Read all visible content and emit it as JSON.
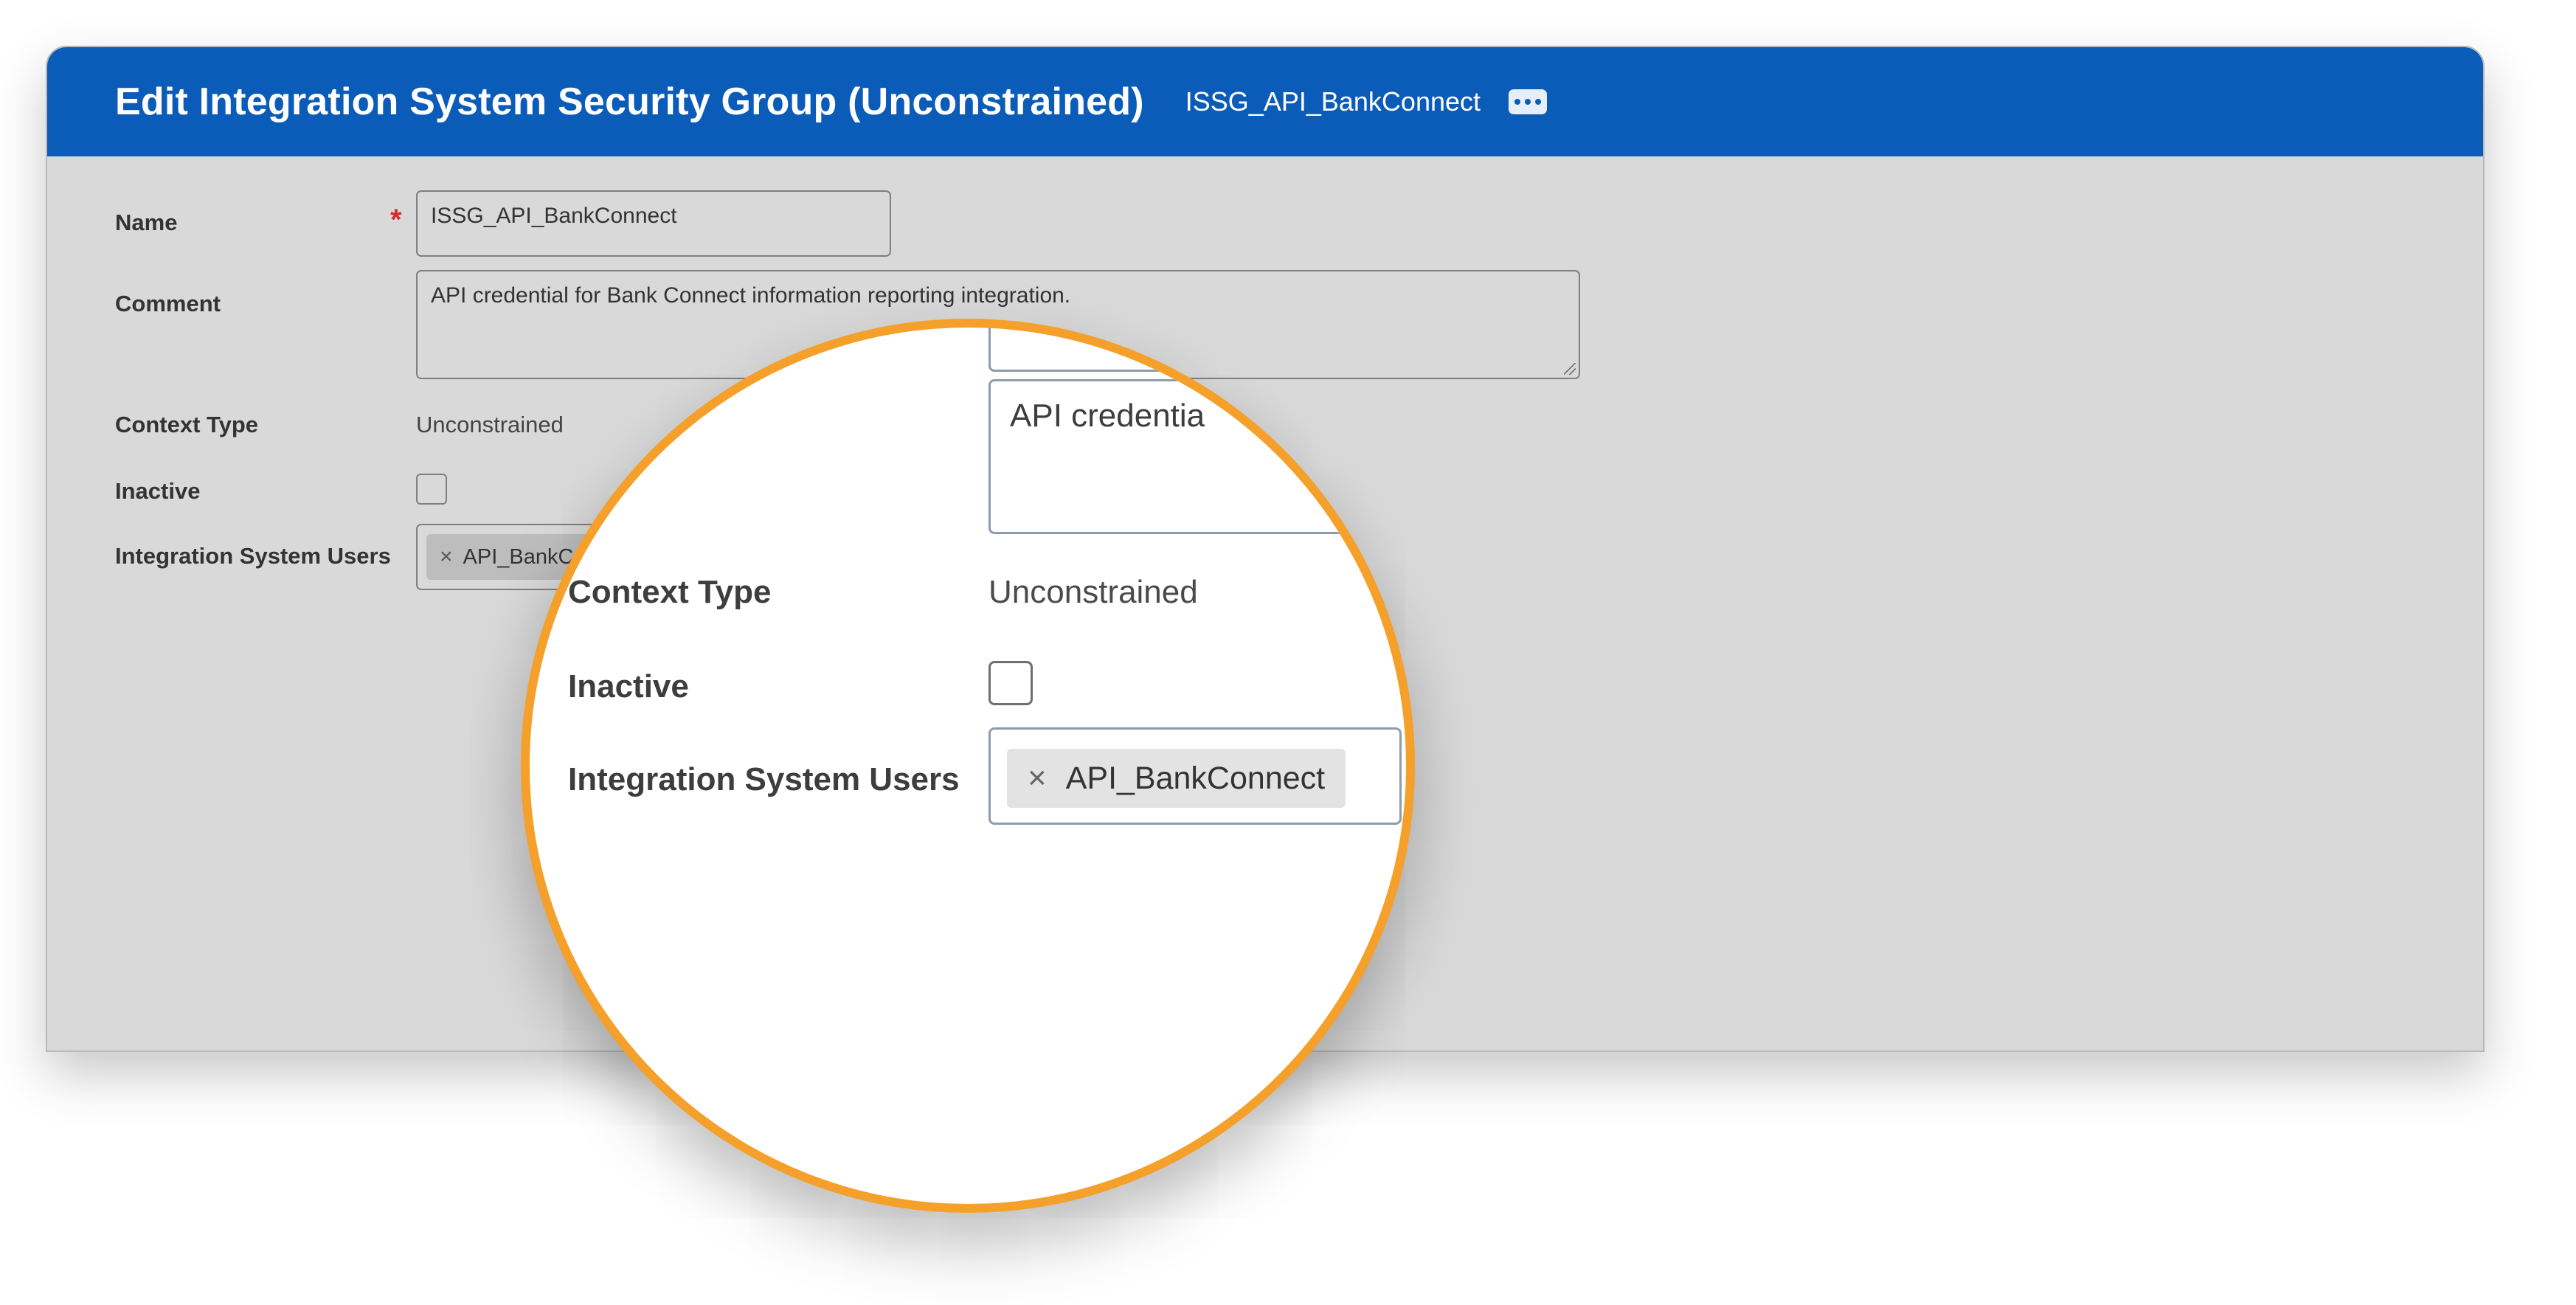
{
  "header": {
    "title": "Edit Integration System Security Group (Unconstrained)",
    "subtitle": "ISSG_API_BankConnect",
    "more_icon": "ellipsis-icon"
  },
  "form": {
    "name_label": "Name",
    "required_marker": "*",
    "name_value": "ISSG_API_BankConnect",
    "comment_label": "Comment",
    "comment_value": "API credential for Bank Connect information reporting integration.",
    "context_type_label": "Context Type",
    "context_type_value": "Unconstrained",
    "inactive_label": "Inactive",
    "inactive_checked": false,
    "isu_label": "Integration System Users",
    "isu_pill_visible": "API_BankC",
    "remove_icon": "close-icon"
  },
  "magnifier": {
    "comment_value_visible": "API credentia",
    "context_type_label": "Context Type",
    "context_type_value": "Unconstrained",
    "inactive_label": "Inactive",
    "isu_label": "Integration System Users",
    "isu_pill": "API_BankConnect",
    "remove_glyph": "×",
    "border_color": "#f5a02a"
  },
  "colors": {
    "header_bg": "#0b5cb8",
    "panel_bg": "#d9d9d9",
    "required": "#d62b2b"
  }
}
